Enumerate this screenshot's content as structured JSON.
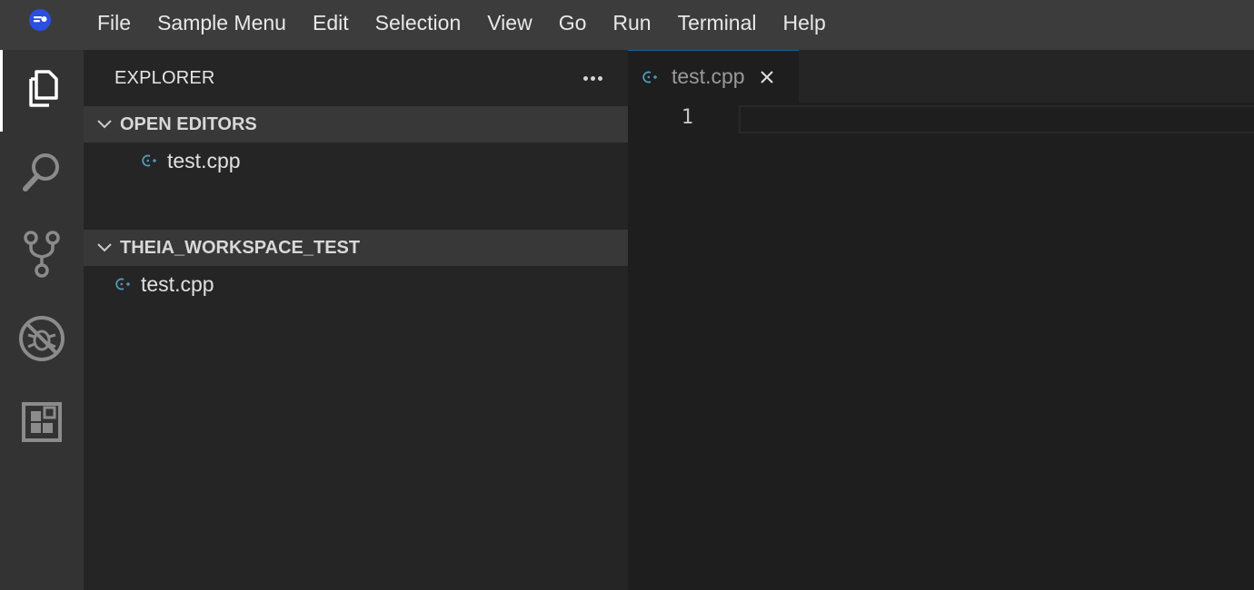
{
  "menubar": {
    "logo_icon": "theia-logo-icon",
    "items": [
      "File",
      "Sample Menu",
      "Edit",
      "Selection",
      "View",
      "Go",
      "Run",
      "Terminal",
      "Help"
    ]
  },
  "activitybar": {
    "items": [
      {
        "icon": "explorer-files-icon",
        "active": true
      },
      {
        "icon": "search-icon",
        "active": false
      },
      {
        "icon": "source-control-icon",
        "active": false
      },
      {
        "icon": "debug-disabled-icon",
        "active": false
      },
      {
        "icon": "extensions-icon",
        "active": false
      }
    ]
  },
  "sidebar": {
    "title": "EXPLORER",
    "more_icon": "more-actions-icon",
    "open_editors": {
      "title": "OPEN EDITORS",
      "files": [
        "test.cpp"
      ]
    },
    "workspace": {
      "title": "THEIA_WORKSPACE_TEST",
      "files": [
        "test.cpp"
      ]
    }
  },
  "editor": {
    "tab": {
      "label": "test.cpp",
      "icon": "cpp-file-icon"
    },
    "line_number": "1"
  },
  "colors": {
    "menubar_bg": "#3c3c3c",
    "activitybar_bg": "#333333",
    "sidebar_bg": "#252526",
    "section_header_bg": "#383838",
    "editor_bg": "#1e1e1e",
    "cpp_icon": "#519aba",
    "logo_blue": "#2b4fe0"
  }
}
